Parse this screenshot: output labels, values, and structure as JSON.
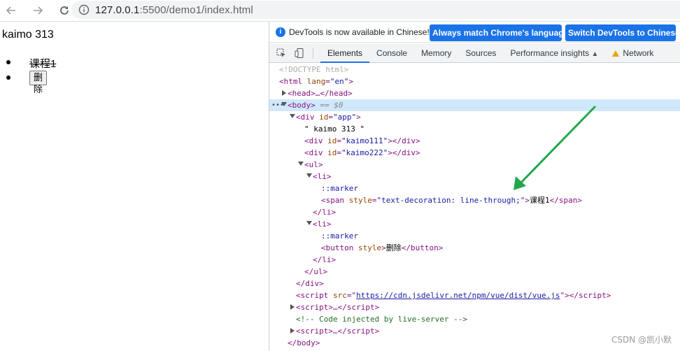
{
  "browser": {
    "url_host": "127.0.0.1",
    "url_rest": ":5500/demo1/index.html"
  },
  "page": {
    "heading": "kaimo 313",
    "items": [
      {
        "text": "课程1",
        "strike": true
      },
      {
        "button": "删除"
      }
    ]
  },
  "devtools": {
    "infobar_message": "DevTools is now available in Chinese!",
    "btn_match": "Always match Chrome's language",
    "btn_switch": "Switch DevTools to Chinese",
    "tabs": [
      "Elements",
      "Console",
      "Memory",
      "Sources",
      "Performance insights",
      "Network"
    ],
    "active_tab": "Elements",
    "dom": {
      "doctype": "<!DOCTYPE html>",
      "html_open": "<html",
      "html_attr": "lang",
      "html_val": "\"en\"",
      "head": "<head>…</head>",
      "body": "<body>",
      "body_eq": "== $0",
      "div_app_attr": "id",
      "div_app_val": "\"app\"",
      "text_node": "\" kaimo 313 \"",
      "div1_val": "\"kaimo111\"",
      "div2_val": "\"kaimo222\"",
      "marker": "::marker",
      "span_style_val": "\"text-decoration: line-through;\"",
      "span_text": "课程1",
      "button_text": "删除",
      "script_src_val": "https://cdn.jsdelivr.net/npm/vue/dist/vue.js",
      "comment": "<!-- Code injected by live-server -->"
    }
  },
  "watermark": "CSDN @凯小默",
  "colors": {
    "accent": "#1a73e8",
    "arrow": "#22a84a"
  }
}
